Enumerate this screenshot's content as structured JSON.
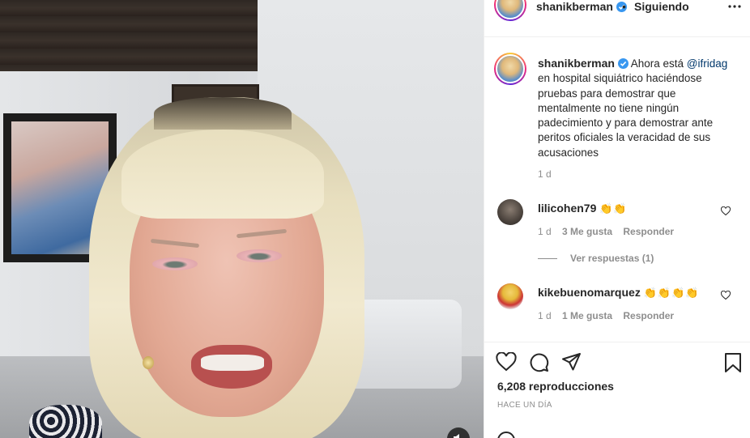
{
  "post": {
    "username": "shanikberman",
    "follow_status": "Siguiendo",
    "separator": "•",
    "caption_mention": "@ifridag",
    "caption_before": "Ahora está",
    "caption_after": "en hospital siquiátrico haciéndose pruebas para demostrar que mentalmente no tiene ningún padecimiento y para demostrar ante peritos oficiales la veracidad de sus acusaciones",
    "caption_time": "1 d",
    "views": "6,208 reproducciones",
    "posted_ago": "HACE UN DÍA"
  },
  "comments": [
    {
      "username": "lilicohen79",
      "emojis": "👏👏",
      "time": "1 d",
      "likes": "3 Me gusta",
      "reply": "Responder",
      "view_replies": "Ver respuestas (1)"
    },
    {
      "username": "kikebuenomarquez",
      "emojis": "👏👏👏👏",
      "time": "1 d",
      "likes": "1 Me gusta",
      "reply": "Responder"
    }
  ],
  "icons": {
    "verified": "verified-badge-icon",
    "more": "more-options-icon",
    "like": "heart-icon",
    "comment": "comment-icon",
    "share": "share-icon",
    "save": "bookmark-icon",
    "mute": "volume-icon"
  },
  "colors": {
    "text": "#262626",
    "muted": "#8e8e8e",
    "verified": "#3897f0",
    "mention": "#00376b",
    "border": "#efefef"
  }
}
